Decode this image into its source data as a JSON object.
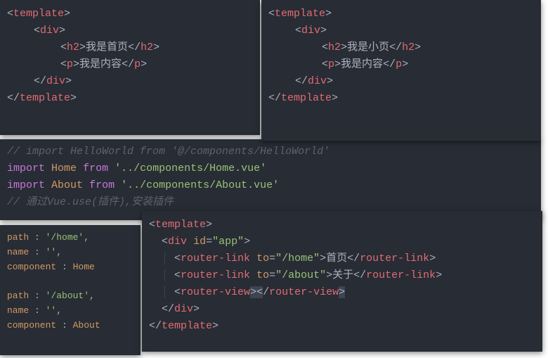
{
  "home_panel": {
    "tag_template": "template",
    "tag_div": "div",
    "tag_h2": "h2",
    "tag_p": "p",
    "h2_text": "我是首页",
    "p_text": "我是内容"
  },
  "about_panel": {
    "tag_template": "template",
    "tag_div": "div",
    "tag_h2": "h2",
    "tag_p": "p",
    "h2_text": "我是小页",
    "p_text": "我是内容"
  },
  "imports_panel": {
    "comment1": "// import HelloWorld from '@/components/HelloWorld'",
    "kw_import": "import",
    "kw_from": "from",
    "ident_home": "Home",
    "ident_about": "About",
    "path_home": "'../components/Home.vue'",
    "path_about": "'../components/About.vue'",
    "comment2": "// 通过Vue.use(插件),安装插件"
  },
  "routes_panel": {
    "route1": {
      "path_key": "path",
      "path_val": "'/home'",
      "name_key": "name",
      "name_val": "''",
      "comp_key": "component",
      "comp_val": "Home"
    },
    "route2": {
      "path_key": "path",
      "path_val": "'/about'",
      "name_key": "name",
      "name_val": "''",
      "comp_key": "component",
      "comp_val": "About"
    }
  },
  "app_panel": {
    "tag_template": "template",
    "tag_div": "div",
    "attr_id": "id",
    "val_app": "\"app\"",
    "tag_router_link": "router-link",
    "attr_to": "to",
    "val_home": "\"/home\"",
    "val_about": "\"/about\"",
    "link_home_text": "首页",
    "link_about_text": "关于",
    "tag_router_view": "router-view"
  }
}
